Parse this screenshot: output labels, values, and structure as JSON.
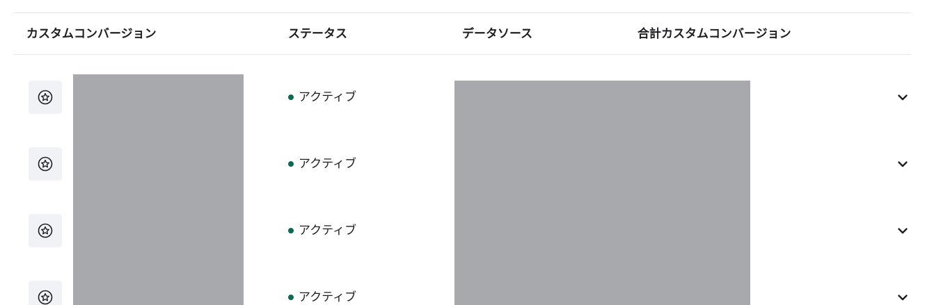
{
  "table": {
    "columns": [
      "カスタムコンバージョン",
      "ステータス",
      "データソース",
      "合計カスタムコンバージョン"
    ],
    "rows": [
      {
        "status_label": "アクティブ",
        "icon": "star-circle-icon"
      },
      {
        "status_label": "アクティブ",
        "icon": "star-circle-icon"
      },
      {
        "status_label": "アクティブ",
        "icon": "star-circle-icon"
      },
      {
        "status_label": "アクティブ",
        "icon": "star-circle-icon"
      }
    ]
  },
  "colors": {
    "status_active": "#0b6b52",
    "redacted": "#a8a9ad",
    "icon_bg": "#f0f2f5",
    "border": "#e4e6eb"
  }
}
